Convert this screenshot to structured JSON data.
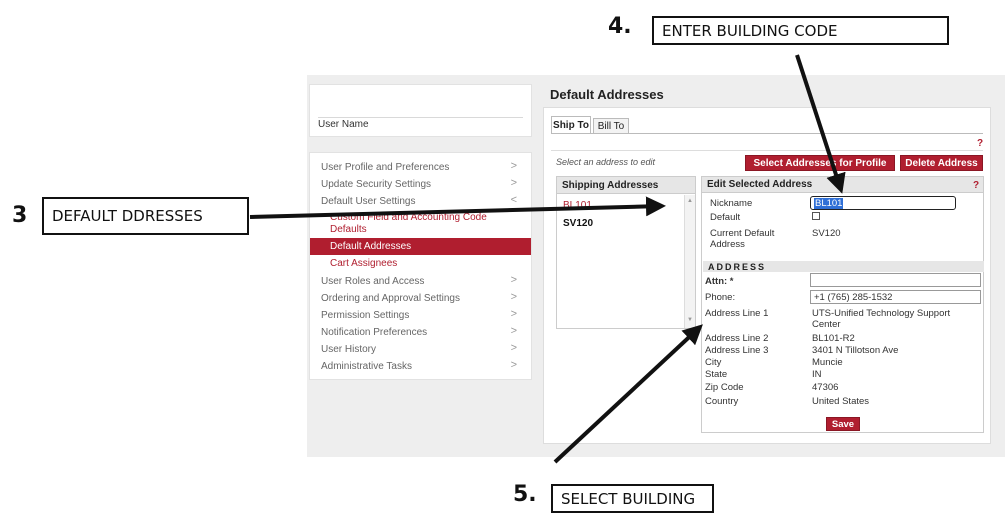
{
  "callouts": {
    "step4": {
      "num": "4.",
      "text": "ENTER BUILDING CODE"
    },
    "step3": {
      "num": "3",
      "text": "DEFAULT DDRESSES"
    },
    "step5": {
      "num": "5.",
      "text": "SELECT BUILDING"
    }
  },
  "sidebar": {
    "user_name": "User Name",
    "items": [
      {
        "label": "User Profile and Preferences",
        "chev": ">"
      },
      {
        "label": "Update Security Settings",
        "chev": ">"
      },
      {
        "label": "Default User Settings",
        "chev": "<"
      },
      {
        "label": "Custom Field and Accounting Code Defaults",
        "chev": ""
      },
      {
        "label": "Default Addresses",
        "chev": ""
      },
      {
        "label": "Cart Assignees",
        "chev": ""
      },
      {
        "label": "User Roles and Access",
        "chev": ">"
      },
      {
        "label": "Ordering and Approval Settings",
        "chev": ">"
      },
      {
        "label": "Permission Settings",
        "chev": ">"
      },
      {
        "label": "Notification Preferences",
        "chev": ">"
      },
      {
        "label": "User History",
        "chev": ">"
      },
      {
        "label": "Administrative Tasks",
        "chev": ">"
      }
    ]
  },
  "main": {
    "title": "Default Addresses",
    "tabs": [
      "Ship To",
      "Bill To"
    ],
    "help": "?",
    "select_hint": "Select an address to edit",
    "btn_select_profile": "Select Addresses for Profile",
    "btn_delete": "Delete Address",
    "shipping": {
      "header": "Shipping Addresses",
      "items": [
        "BL101",
        "SV120"
      ],
      "scroll_up": "▲",
      "scroll_down": "▼"
    },
    "edit": {
      "header": "Edit Selected Address",
      "help": "?",
      "nickname_label": "Nickname",
      "nickname_value": "BL101",
      "default_label": "Default",
      "current_default_label": "Current Default Address",
      "current_default_value": "SV120",
      "address_band": "ADDRESS",
      "attn_label": "Attn: *",
      "attn_value": "",
      "phone_label": "Phone:",
      "phone_value": "+1 (765) 285-1532",
      "rows": [
        {
          "label": "Address Line 1",
          "value": "UTS-Unified Technology Support Center"
        },
        {
          "label": "Address Line 2",
          "value": "BL101-R2"
        },
        {
          "label": "Address Line 3",
          "value": "3401 N Tillotson Ave"
        },
        {
          "label": "City",
          "value": "Muncie"
        },
        {
          "label": "State",
          "value": "IN"
        },
        {
          "label": "Zip Code",
          "value": "47306"
        },
        {
          "label": "Country",
          "value": "United States"
        }
      ],
      "save_label": "Save"
    }
  },
  "colors": {
    "accent": "#b01e2f"
  }
}
